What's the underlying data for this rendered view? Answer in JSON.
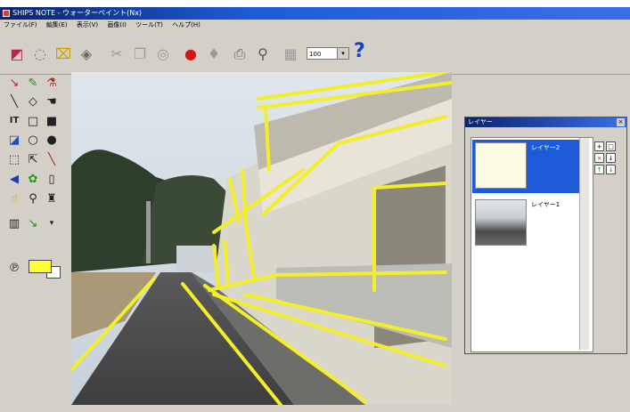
{
  "window": {
    "title": "SHIPS NOTE - ウォーターペイント(Nx)"
  },
  "menu": {
    "items": [
      "ファイル(F)",
      "編集(E)",
      "表示(V)",
      "画像(I)",
      "ツール(T)",
      "ヘルプ(H)"
    ]
  },
  "toolbar": {
    "zoom_value": "100",
    "help_label": "?",
    "icons": [
      "new-icon",
      "open-icon",
      "folder-icon",
      "save-icon",
      "cut-icon",
      "copy-icon",
      "paste-icon",
      "undo-icon",
      "redo-icon",
      "print-icon",
      "zoom-icon",
      "grid-icon"
    ]
  },
  "toolbox": {
    "tools": [
      "pen-tool",
      "brush-tool",
      "fill-tool",
      "line-tool",
      "shape-tool",
      "hand-tool",
      "text-tool",
      "rect-tool",
      "filled-rect-tool",
      "eraser-tool",
      "ellipse-tool",
      "filled-ellipse-tool",
      "select-tool",
      "move-tool",
      "picker-tool",
      "lasso-tool",
      "stamp-tool",
      "blank-tool",
      "magnet-tool",
      "magnifier-tool",
      "lock-tool",
      "paint-tool",
      "pencil-tool",
      "dropdown-tool",
      "palette-tool"
    ],
    "fg_color": "#ffff33",
    "bg_color": "#ffffff"
  },
  "layers_panel": {
    "title": "レイヤー",
    "close_label": "×",
    "layers": [
      {
        "name": "レイヤー2",
        "selected": true
      },
      {
        "name": "レイヤー1",
        "selected": false
      }
    ],
    "buttons": [
      "+",
      "□",
      "×",
      "↓",
      "↑",
      "↓"
    ]
  },
  "colors": {
    "accent_line": "#f2ef2a",
    "title_blue": "#1e5bd8"
  }
}
